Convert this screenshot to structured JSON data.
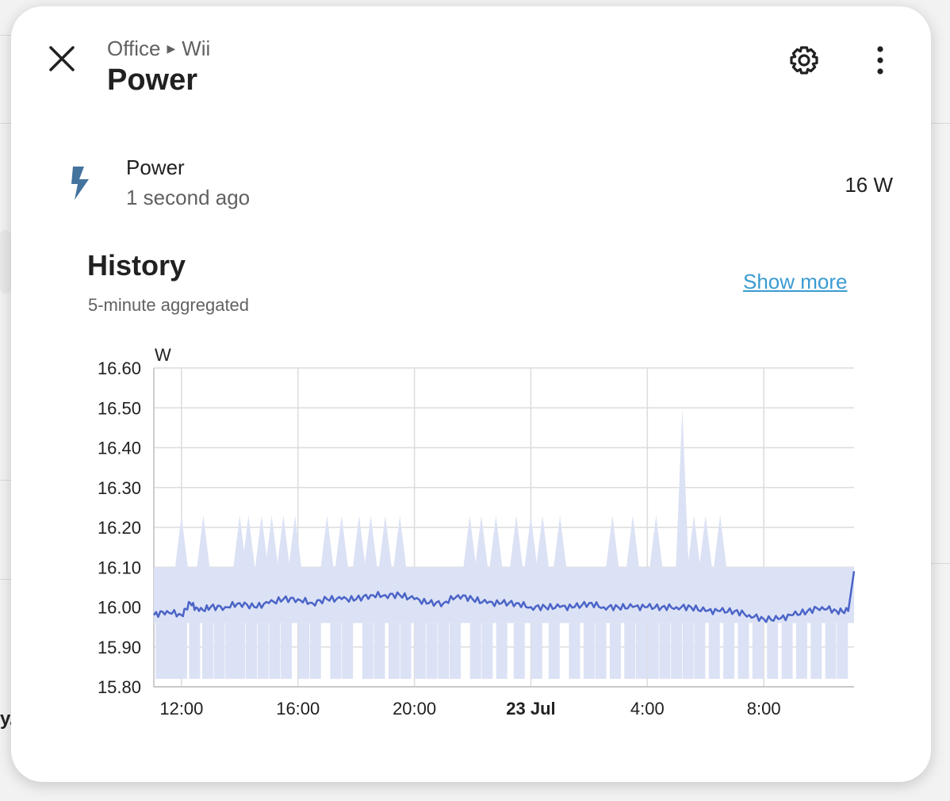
{
  "header": {
    "breadcrumb_area": "Office",
    "breadcrumb_device": "Wii",
    "title": "Power",
    "icons": {
      "close": "close-icon",
      "settings": "gear-icon",
      "more": "dots-vertical-icon"
    }
  },
  "entity": {
    "icon": "lightning-bolt-icon",
    "name": "Power",
    "last_changed": "1 second ago",
    "state": "16 W"
  },
  "history": {
    "title": "History",
    "subtitle": "5-minute aggregated",
    "show_more": "Show more"
  },
  "background": {
    "partial_text": "y."
  },
  "colors": {
    "accent_line": "#4b64c8",
    "band_fill": "#dce2f5",
    "link": "#3a9bd1",
    "icon": "#44739e"
  },
  "chart_data": {
    "type": "line",
    "unit_label": "W",
    "y_ticks": [
      "16.60",
      "16.50",
      "16.40",
      "16.30",
      "16.20",
      "16.10",
      "16.00",
      "15.90",
      "15.80"
    ],
    "ylim": [
      15.8,
      16.6
    ],
    "x_ticks": [
      {
        "label": "12:00",
        "hour": 12,
        "bold": false
      },
      {
        "label": "16:00",
        "hour": 16,
        "bold": false
      },
      {
        "label": "20:00",
        "hour": 20,
        "bold": false
      },
      {
        "label": "23 Jul",
        "hour": 24,
        "bold": true
      },
      {
        "label": "4:00",
        "hour": 28,
        "bold": false
      },
      {
        "label": "8:00",
        "hour": 32,
        "bold": false
      }
    ],
    "xlim_hours": [
      11.05,
      35.1
    ],
    "grid": true,
    "series": [
      {
        "kind": "mean",
        "points": [
          [
            11.05,
            15.98
          ],
          [
            11.5,
            15.99
          ],
          [
            12.0,
            15.98
          ],
          [
            12.3,
            16.01
          ],
          [
            12.6,
            15.99
          ],
          [
            13.0,
            16.0
          ],
          [
            13.5,
            16.0
          ],
          [
            14.0,
            16.01
          ],
          [
            14.5,
            16.0
          ],
          [
            15.0,
            16.01
          ],
          [
            15.5,
            16.02
          ],
          [
            16.0,
            16.02
          ],
          [
            16.5,
            16.01
          ],
          [
            17.0,
            16.02
          ],
          [
            17.5,
            16.02
          ],
          [
            18.0,
            16.02
          ],
          [
            18.5,
            16.03
          ],
          [
            19.0,
            16.03
          ],
          [
            19.5,
            16.03
          ],
          [
            20.0,
            16.02
          ],
          [
            20.5,
            16.01
          ],
          [
            21.0,
            16.01
          ],
          [
            21.5,
            16.03
          ],
          [
            22.0,
            16.02
          ],
          [
            22.5,
            16.01
          ],
          [
            23.0,
            16.01
          ],
          [
            23.5,
            16.01
          ],
          [
            24.0,
            16.0
          ],
          [
            24.5,
            16.0
          ],
          [
            25.0,
            16.0
          ],
          [
            25.5,
            16.0
          ],
          [
            26.0,
            16.01
          ],
          [
            26.5,
            16.0
          ],
          [
            27.0,
            16.0
          ],
          [
            27.5,
            16.0
          ],
          [
            28.0,
            16.0
          ],
          [
            28.5,
            16.0
          ],
          [
            29.0,
            16.0
          ],
          [
            29.5,
            16.0
          ],
          [
            30.0,
            15.99
          ],
          [
            30.5,
            15.99
          ],
          [
            31.0,
            15.99
          ],
          [
            31.5,
            15.98
          ],
          [
            32.0,
            15.97
          ],
          [
            32.5,
            15.97
          ],
          [
            33.0,
            15.98
          ],
          [
            33.5,
            15.99
          ],
          [
            34.0,
            16.0
          ],
          [
            34.5,
            15.99
          ],
          [
            34.9,
            15.99
          ],
          [
            35.1,
            16.09
          ]
        ]
      },
      {
        "kind": "max_band",
        "baseline": 16.1,
        "spikes": [
          [
            12.0,
            16.23
          ],
          [
            12.75,
            16.23
          ],
          [
            14.0,
            16.23
          ],
          [
            14.3,
            16.23
          ],
          [
            14.75,
            16.23
          ],
          [
            15.1,
            16.23
          ],
          [
            15.5,
            16.23
          ],
          [
            15.9,
            16.23
          ],
          [
            17.0,
            16.23
          ],
          [
            17.5,
            16.23
          ],
          [
            18.1,
            16.23
          ],
          [
            18.5,
            16.23
          ],
          [
            19.0,
            16.23
          ],
          [
            19.5,
            16.23
          ],
          [
            21.9,
            16.23
          ],
          [
            22.3,
            16.23
          ],
          [
            22.8,
            16.23
          ],
          [
            23.5,
            16.23
          ],
          [
            24.0,
            16.23
          ],
          [
            24.4,
            16.23
          ],
          [
            25.0,
            16.23
          ],
          [
            26.8,
            16.23
          ],
          [
            27.5,
            16.23
          ],
          [
            28.3,
            16.23
          ],
          [
            29.2,
            16.5
          ],
          [
            29.6,
            16.23
          ],
          [
            30.0,
            16.23
          ],
          [
            30.5,
            16.23
          ]
        ]
      },
      {
        "kind": "min_band",
        "baseline": 15.96,
        "dips": [
          [
            11.3,
            15.82
          ],
          [
            11.65,
            15.82
          ],
          [
            12.0,
            15.82
          ],
          [
            12.45,
            15.82
          ],
          [
            12.9,
            15.82
          ],
          [
            13.3,
            15.82
          ],
          [
            13.7,
            15.82
          ],
          [
            14.0,
            15.82
          ],
          [
            14.4,
            15.82
          ],
          [
            14.8,
            15.82
          ],
          [
            15.2,
            15.82
          ],
          [
            15.6,
            15.82
          ],
          [
            16.2,
            15.82
          ],
          [
            16.6,
            15.82
          ],
          [
            17.3,
            15.82
          ],
          [
            17.7,
            15.82
          ],
          [
            18.4,
            15.82
          ],
          [
            18.8,
            15.82
          ],
          [
            19.3,
            15.82
          ],
          [
            19.7,
            15.82
          ],
          [
            20.2,
            15.82
          ],
          [
            20.6,
            15.82
          ],
          [
            21.0,
            15.82
          ],
          [
            21.4,
            15.82
          ],
          [
            22.1,
            15.82
          ],
          [
            22.5,
            15.82
          ],
          [
            23.0,
            15.82
          ],
          [
            23.6,
            15.82
          ],
          [
            24.2,
            15.82
          ],
          [
            24.8,
            15.82
          ],
          [
            25.5,
            15.82
          ],
          [
            26.0,
            15.82
          ],
          [
            26.4,
            15.82
          ],
          [
            26.9,
            15.82
          ],
          [
            27.4,
            15.82
          ],
          [
            27.8,
            15.82
          ],
          [
            28.2,
            15.82
          ],
          [
            28.6,
            15.82
          ],
          [
            29.0,
            15.82
          ],
          [
            29.4,
            15.82
          ],
          [
            29.8,
            15.82
          ],
          [
            30.3,
            15.82
          ],
          [
            30.8,
            15.82
          ],
          [
            31.3,
            15.82
          ],
          [
            31.8,
            15.82
          ],
          [
            32.3,
            15.82
          ],
          [
            32.8,
            15.82
          ],
          [
            33.3,
            15.82
          ],
          [
            33.8,
            15.82
          ],
          [
            34.3,
            15.82
          ],
          [
            34.7,
            15.82
          ]
        ]
      }
    ]
  }
}
